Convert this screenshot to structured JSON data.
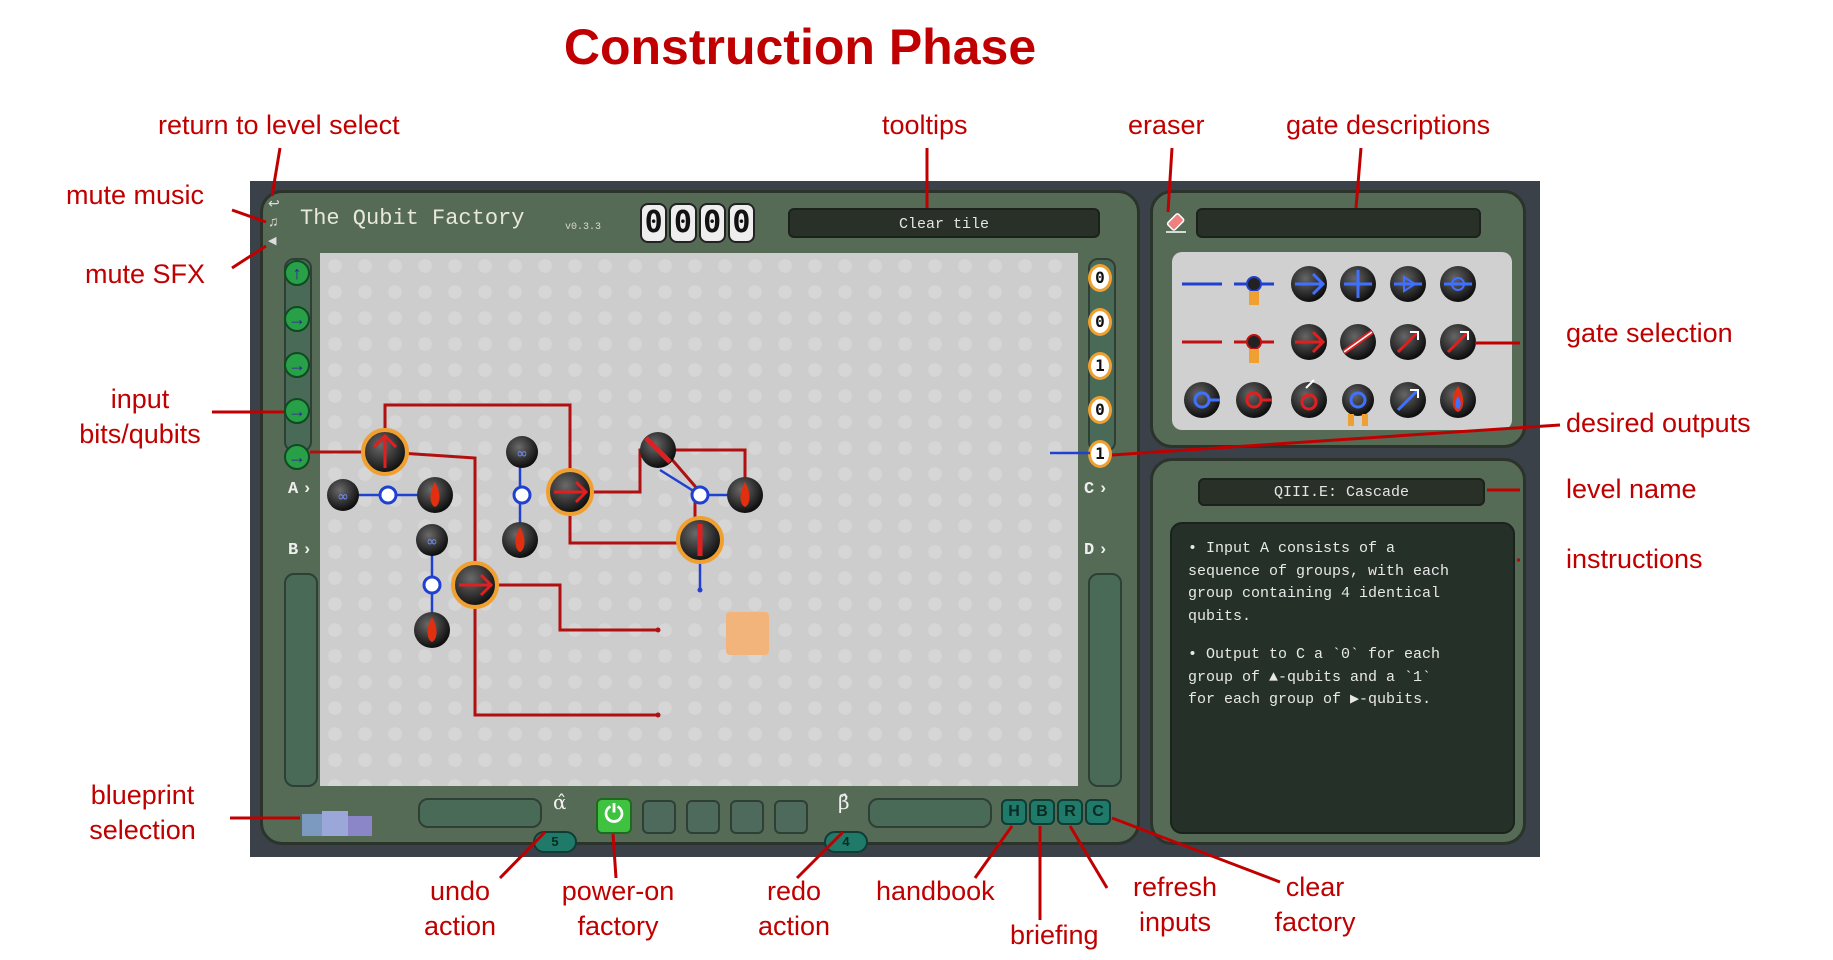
{
  "page_title": "Construction Phase",
  "annotations": {
    "return_to_level_select": "return to level select",
    "mute_music": "mute music",
    "mute_sfx": "mute SFX",
    "input_bits": [
      "input",
      "bits/qubits"
    ],
    "tooltips": "tooltips",
    "eraser": "eraser",
    "gate_descriptions": "gate descriptions",
    "gate_selection": "gate selection",
    "desired_outputs": "desired outputs",
    "level_name": "level name",
    "instructions": "instructions",
    "blueprint_selection": [
      "blueprint",
      "selection"
    ],
    "undo_action": [
      "undo",
      "action"
    ],
    "power_on_factory": [
      "power-on",
      "factory"
    ],
    "redo_action": [
      "redo",
      "action"
    ],
    "handbook": "handbook",
    "briefing": "briefing",
    "refresh_inputs": [
      "refresh",
      "inputs"
    ],
    "clear_factory": [
      "clear",
      "factory"
    ]
  },
  "game": {
    "title": "The Qubit Factory",
    "version": "v0.3.3",
    "counter": [
      "0",
      "0",
      "0",
      "0"
    ],
    "tooltip_text": "Clear tile",
    "gate_description_text": "",
    "ports": {
      "a": "A",
      "b": "B",
      "c": "C",
      "d": "D"
    },
    "desired_outputs": [
      "0",
      "0",
      "1",
      "0",
      "1"
    ],
    "level_name": "QIII.E: Cascade",
    "instructions": [
      "• Input A consists of a\nsequence of groups, with each\ngroup containing 4 identical\nqubits.",
      "• Output to C a `0` for each\ngroup of ▲-qubits and a `1`\nfor each group of ▶-qubits."
    ],
    "undo_count": "5",
    "redo_count": "4",
    "alpha": "α̂",
    "beta": "β̂",
    "power_symbol": "⏻",
    "controls": {
      "handbook": "H",
      "briefing": "B",
      "refresh": "R",
      "clear": "C"
    },
    "colors": {
      "frame": "#3a4148",
      "panel": "#566b56",
      "grid": "#cdcdcd",
      "wire_red": "#b01010",
      "wire_blue": "#2040d0",
      "accent_orange": "#f0a030",
      "annotation_red": "#c00000"
    }
  }
}
